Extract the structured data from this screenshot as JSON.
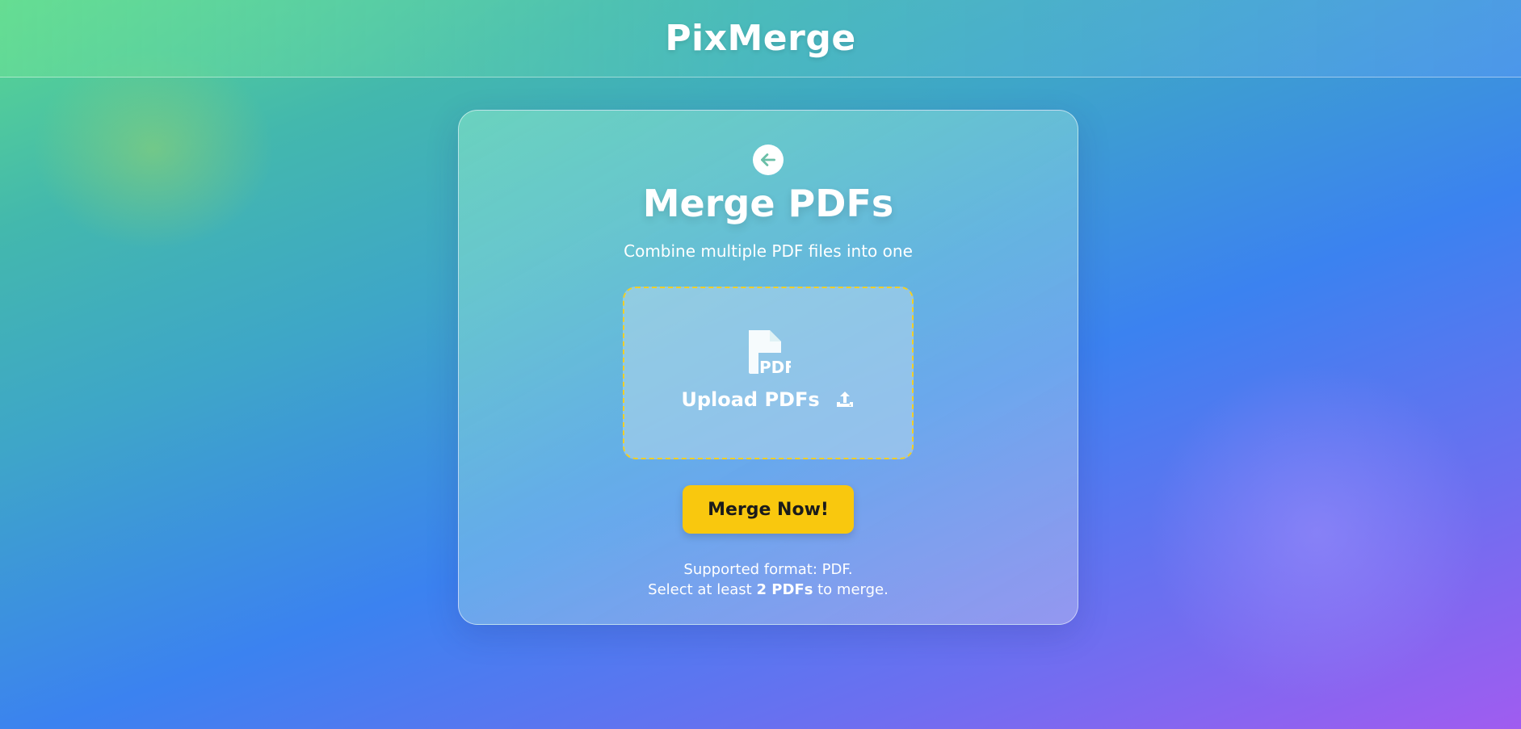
{
  "header": {
    "brand": "PixMerge"
  },
  "card": {
    "back_icon": "arrow-left-icon",
    "title": "Merge PDFs",
    "subtitle": "Combine multiple PDF files into one",
    "upload": {
      "file_icon": "pdf-file-icon",
      "label": "Upload PDFs",
      "upload_icon": "upload-icon",
      "border_color": "#f2cf26"
    },
    "merge_button": "Merge Now!",
    "note": {
      "line1": "Supported format: PDF.",
      "line2_prefix": "Select at least ",
      "line2_bold": "2 PDFs",
      "line2_suffix": " to merge."
    }
  },
  "colors": {
    "accent": "#f9c80e",
    "text": "#ffffff"
  }
}
